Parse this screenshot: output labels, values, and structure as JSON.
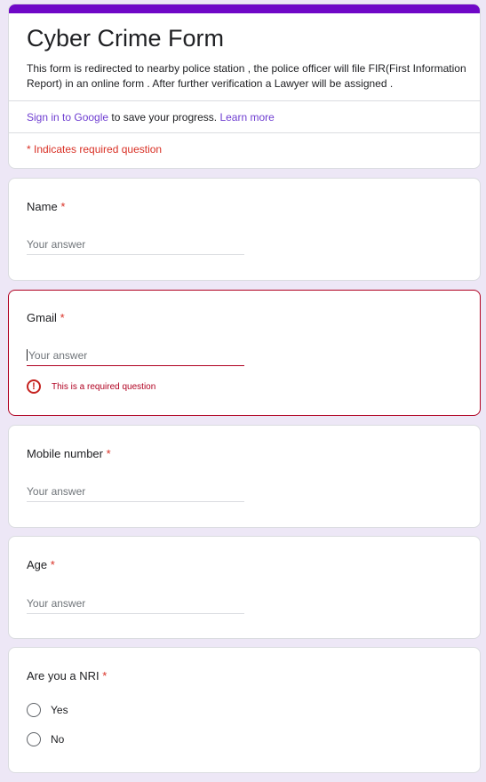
{
  "header": {
    "title": "Cyber Crime Form",
    "description": "This form is redirected to nearby police station , the police officer will file FIR(First Information Report) in an online form . After further verification a Lawyer will be assigned .",
    "sign_in_link": "Sign in to Google",
    "sign_in_text": " to save your progress. ",
    "learn_more": "Learn more",
    "required_note": "* Indicates required question",
    "accent_color": "#6f08c7"
  },
  "questions": [
    {
      "label": "Name",
      "required": "*",
      "placeholder": "Your answer"
    },
    {
      "label": "Gmail",
      "required": "*",
      "placeholder": "Your answer",
      "error": "This is a required question",
      "error_icon": "error-icon"
    },
    {
      "label": "Mobile number",
      "required": "*",
      "placeholder": "Your answer"
    },
    {
      "label": "Age",
      "required": "*",
      "placeholder": "Your answer"
    },
    {
      "label": "Are you a NRI",
      "required": "*",
      "options": [
        "Yes",
        "No"
      ]
    }
  ]
}
